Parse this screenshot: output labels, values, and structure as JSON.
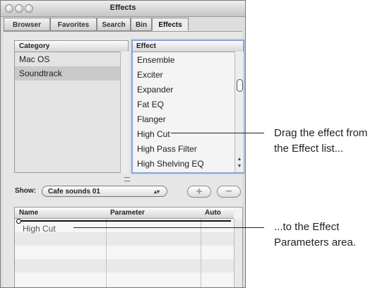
{
  "window": {
    "title": "Effects"
  },
  "tabs": [
    {
      "label": "Browser",
      "active": false
    },
    {
      "label": "Favorites",
      "active": false
    },
    {
      "label": "Search",
      "active": false
    },
    {
      "label": "Bin",
      "active": false
    },
    {
      "label": "Effects",
      "active": true
    }
  ],
  "category_list": {
    "header": "Category",
    "items": [
      "Mac OS",
      "Soundtrack"
    ],
    "selected": "Soundtrack"
  },
  "effect_list": {
    "header": "Effect",
    "items": [
      "Ensemble",
      "Exciter",
      "Expander",
      "Fat EQ",
      "Flanger",
      "High Cut",
      "High Pass Filter",
      "High Shelving EQ"
    ]
  },
  "show": {
    "label": "Show:",
    "value": "Cafe sounds 01"
  },
  "buttons": {
    "add": "+",
    "remove": "−"
  },
  "parameters": {
    "columns": [
      "Name",
      "Parameter",
      "Auto"
    ],
    "dragged_item": "High Cut"
  },
  "callouts": {
    "first_line1": "Drag the effect from",
    "first_line2": "the Effect list...",
    "second_line1": "...to the Effect",
    "second_line2": "Parameters area."
  },
  "colors": {
    "focus_ring": "#86a6d8",
    "selection": "#c9c9c9"
  }
}
